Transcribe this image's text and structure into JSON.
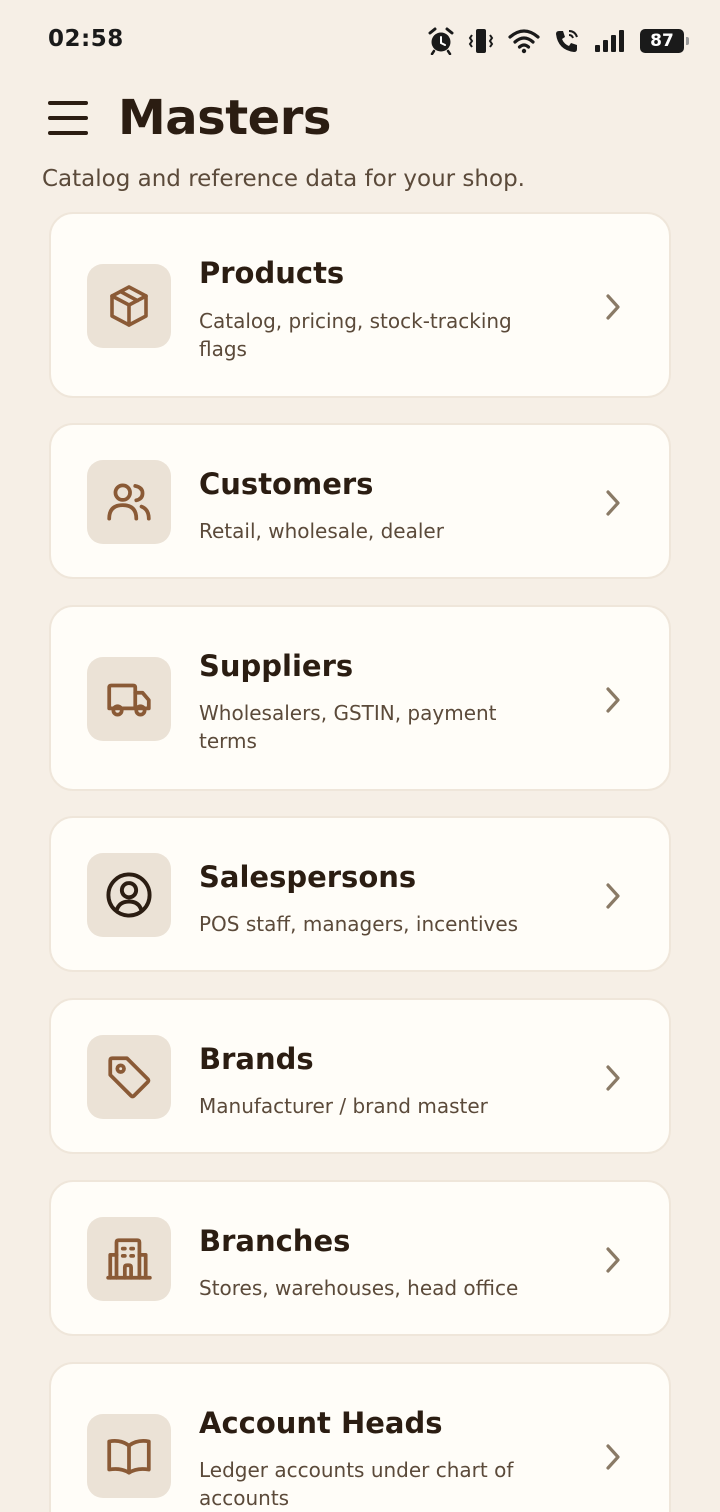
{
  "status_bar": {
    "time": "02:58",
    "battery": "87",
    "icons": [
      "alarm-icon",
      "vibrate-icon",
      "wifi-icon",
      "wifi-call-icon",
      "signal-icon",
      "battery-icon"
    ]
  },
  "header": {
    "menu_icon": "hamburger-menu-icon",
    "title": "Masters",
    "subtitle": "Catalog and reference data for your shop."
  },
  "colors": {
    "background": "#f6efe6",
    "card": "#fffdf8",
    "icon_tile": "#ebe2d6",
    "accent_brown": "#8a5a36",
    "text_dark": "#2b1d12"
  },
  "items": [
    {
      "title": "Products",
      "subtitle": "Catalog, pricing, stock-tracking flags",
      "icon": "box-icon"
    },
    {
      "title": "Customers",
      "subtitle": "Retail, wholesale, dealer",
      "icon": "users-icon"
    },
    {
      "title": "Suppliers",
      "subtitle": "Wholesalers, GSTIN, payment terms",
      "icon": "truck-icon"
    },
    {
      "title": "Salespersons",
      "subtitle": "POS staff, managers, incentives",
      "icon": "user-circle-icon"
    },
    {
      "title": "Brands",
      "subtitle": "Manufacturer / brand master",
      "icon": "tag-icon"
    },
    {
      "title": "Branches",
      "subtitle": "Stores, warehouses, head office",
      "icon": "building-icon"
    },
    {
      "title": "Account Heads",
      "subtitle": "Ledger accounts under chart of accounts",
      "icon": "book-icon"
    }
  ]
}
